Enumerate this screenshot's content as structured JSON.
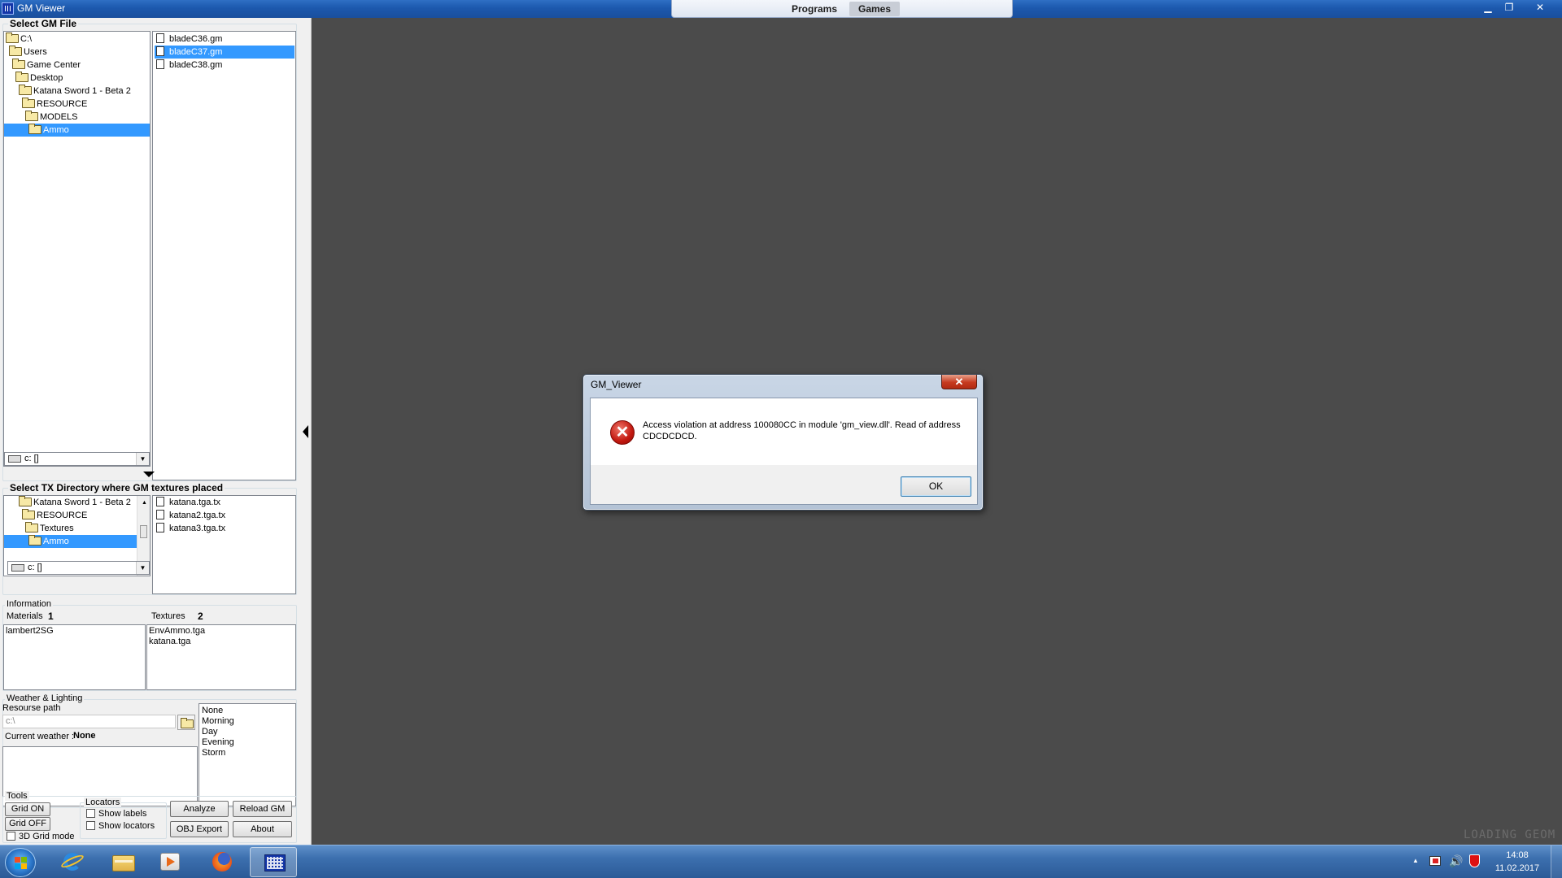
{
  "window": {
    "title": "GM Viewer",
    "minimize_glyph": "▁",
    "restore_glyph": "❐",
    "close_glyph": "✕"
  },
  "program_tabs": [
    "Programs",
    "Games"
  ],
  "select_gm": {
    "title": "Select GM File",
    "tree": [
      "C:\\",
      "Users",
      "Game Center",
      "Desktop",
      "Katana Sword 1 - Beta 2",
      "RESOURCE",
      "MODELS",
      "Ammo"
    ],
    "selected_folder": "Ammo",
    "drive": "c: []",
    "files": [
      "bladeC36.gm",
      "bladeC37.gm",
      "bladeC38.gm"
    ],
    "selected_file": "bladeC37.gm"
  },
  "select_tx": {
    "title": "Select TX Directory where GM textures placed",
    "tree": [
      "Katana Sword 1 - Beta 2",
      "RESOURCE",
      "Textures",
      "Ammo"
    ],
    "selected_folder": "Ammo",
    "drive": "c: []",
    "files": [
      "katana.tga.tx",
      "katana2.tga.tx",
      "katana3.tga.tx"
    ]
  },
  "information": {
    "title": "Information",
    "materials_label": "Materials",
    "materials_count": "1",
    "textures_label": "Textures",
    "textures_count": "2",
    "materials": [
      "lambert2SG"
    ],
    "textures": [
      "EnvAmmo.tga",
      "katana.tga"
    ]
  },
  "weather": {
    "title": "Weather & Lighting",
    "resource_path_label": "Resourse path",
    "resource_path_value": "c:\\",
    "current_weather_label": "Current weather :",
    "current_weather_value": "None",
    "options": [
      "None",
      "Morning",
      "Day",
      "Evening",
      "Storm"
    ]
  },
  "tools": {
    "title": "Tools",
    "grid_on": "Grid ON",
    "grid_off": "Grid OFF",
    "grid_3d": "3D Grid mode",
    "locators_title": "Locators",
    "show_labels": "Show labels",
    "show_locators": "Show locators",
    "analyze": "Analyze",
    "reload": "Reload GM",
    "obj_export": "OBJ Export",
    "about": "About"
  },
  "viewport": {
    "status_text": "LOADING GEOM"
  },
  "dialog": {
    "title": "GM_Viewer",
    "close_glyph": "✕",
    "error_glyph": "✕",
    "message": "Access violation at address 100080CC in module 'gm_view.dll'. Read of address CDCDCDCD.",
    "ok_label": "OK"
  },
  "taskbar": {
    "time": "14:08",
    "date": "11.02.2017",
    "tray_arrow": "▲"
  },
  "colors": {
    "selection": "#3399ff",
    "viewport_bg": "#4b4b4b",
    "titlebar": "#1c58ad",
    "error_red": "#c2180f"
  },
  "icons": [
    "app-icon",
    "folder-icon",
    "file-icon",
    "drive-icon",
    "error-icon",
    "start-orb-icon",
    "internet-explorer-icon",
    "explorer-icon",
    "media-player-icon",
    "firefox-icon",
    "gm-viewer-icon",
    "flag-icon",
    "volume-icon",
    "antivirus-icon"
  ]
}
